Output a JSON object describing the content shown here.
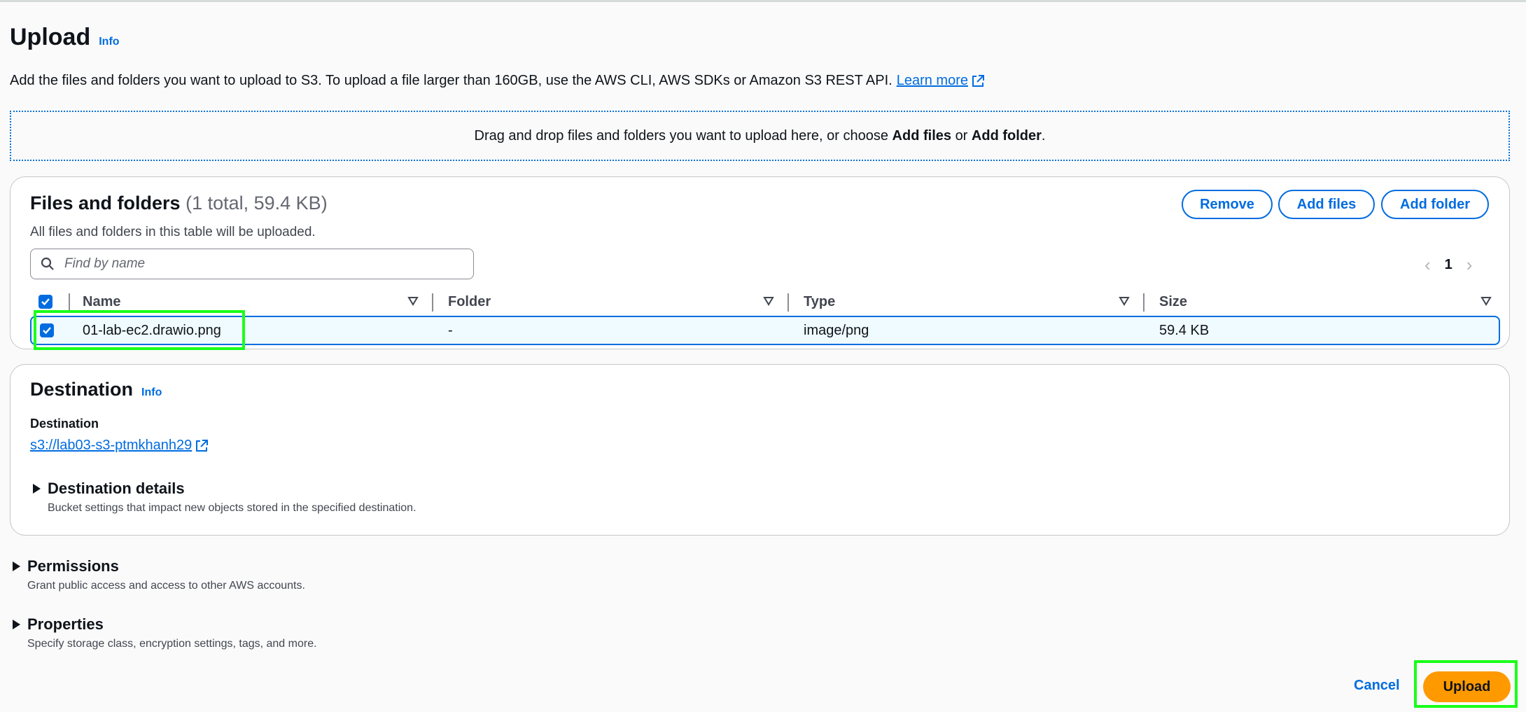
{
  "header": {
    "title": "Upload",
    "info": "Info",
    "description": "Add the files and folders you want to upload to S3. To upload a file larger than 160GB, use the AWS CLI, AWS SDKs or Amazon S3 REST API.",
    "learn_more": "Learn more"
  },
  "dropzone": {
    "text_prefix": "Drag and drop files and folders you want to upload here, or choose",
    "add_files": "Add files",
    "or": "or",
    "add_folder": "Add folder",
    "suffix": "."
  },
  "files": {
    "title": "Files and folders",
    "count": "(1 total, 59.4 KB)",
    "subtitle": "All files and folders in this table will be uploaded.",
    "buttons": {
      "remove": "Remove",
      "add_files": "Add files",
      "add_folder": "Add folder"
    },
    "search_placeholder": "Find by name",
    "page": "1",
    "columns": {
      "name": "Name",
      "folder": "Folder",
      "type": "Type",
      "size": "Size"
    },
    "rows": [
      {
        "name": "01-lab-ec2.drawio.png",
        "folder": "-",
        "type": "image/png",
        "size": "59.4 KB",
        "selected": true
      }
    ]
  },
  "destination": {
    "title": "Destination",
    "info": "Info",
    "label": "Destination",
    "link": "s3://lab03-s3-ptmkhanh29",
    "details_title": "Destination details",
    "details_desc": "Bucket settings that impact new objects stored in the specified destination."
  },
  "permissions": {
    "title": "Permissions",
    "desc": "Grant public access and access to other AWS accounts."
  },
  "properties": {
    "title": "Properties",
    "desc": "Specify storage class, encryption settings, tags, and more."
  },
  "footer": {
    "cancel": "Cancel",
    "upload": "Upload"
  },
  "colors": {
    "accent": "#006ce0",
    "primary_button": "#ff9900",
    "highlight": "#1aff1a"
  }
}
